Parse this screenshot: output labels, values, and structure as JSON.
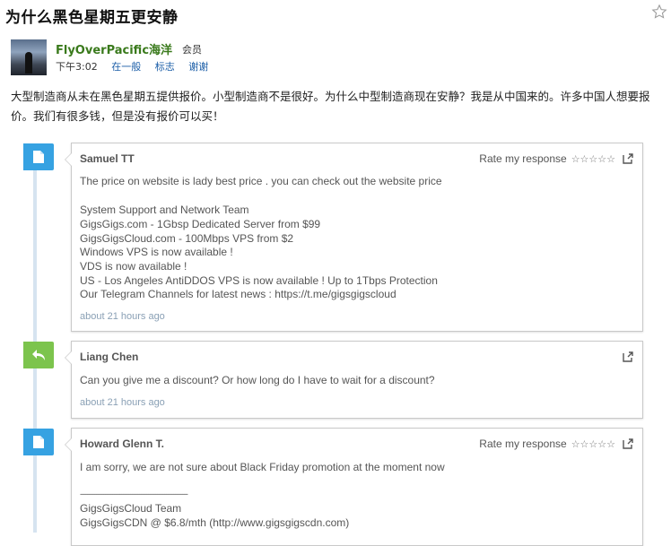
{
  "post": {
    "title": "为什么黑色星期五更安静",
    "username": "FlyOverPacific海洋",
    "role": "会员",
    "time": "下午3:02",
    "category": "在一般",
    "flag": "标志",
    "thanks": "谢谢",
    "body": "大型制造商从未在黑色星期五提供报价。小型制造商不是很好。为什么中型制造商现在安静？我是从中国来的。许多中国人想要报价。我们有很多钱，但是没有报价可以买！"
  },
  "rate_label": "Rate my response",
  "comments": [
    {
      "author": "Samuel TT",
      "badge": "document-icon",
      "badge_color": "#36a2e2",
      "lines": [
        "The price on website is lady best price . you can check out the website price",
        "",
        "System Support and Network Team",
        "GigsGigs.com - 1Gbsp Dedicated Server from $99",
        "GigsGigsCloud.com - 100Mbps VPS from $2",
        "Windows VPS is now available !",
        "VDS is now available !",
        "US - Los Angeles AntiDDOS VPS is now available ! Up to 1Tbps Protection",
        "Our Telegram Channels for latest news : https://t.me/gigsgigscloud"
      ],
      "time": "about 21 hours ago"
    },
    {
      "author": "Liang Chen",
      "badge": "reply-icon",
      "badge_color": "#7cc44d",
      "lines": [
        "Can you give me a discount? Or how long do I have to wait for a discount?"
      ],
      "time": "about 21 hours ago"
    },
    {
      "author": "Howard Glenn T.",
      "badge": "document-icon",
      "badge_color": "#36a2e2",
      "lines": [
        "I am sorry, we are not sure about Black Friday promotion at the moment now",
        "",
        "------------------------------------------------------------",
        "GigsGigsCloud Team",
        "GigsGigsCDN @ $6.8/mth (http://www.gigsgigscdn.com)"
      ],
      "time": ""
    }
  ]
}
